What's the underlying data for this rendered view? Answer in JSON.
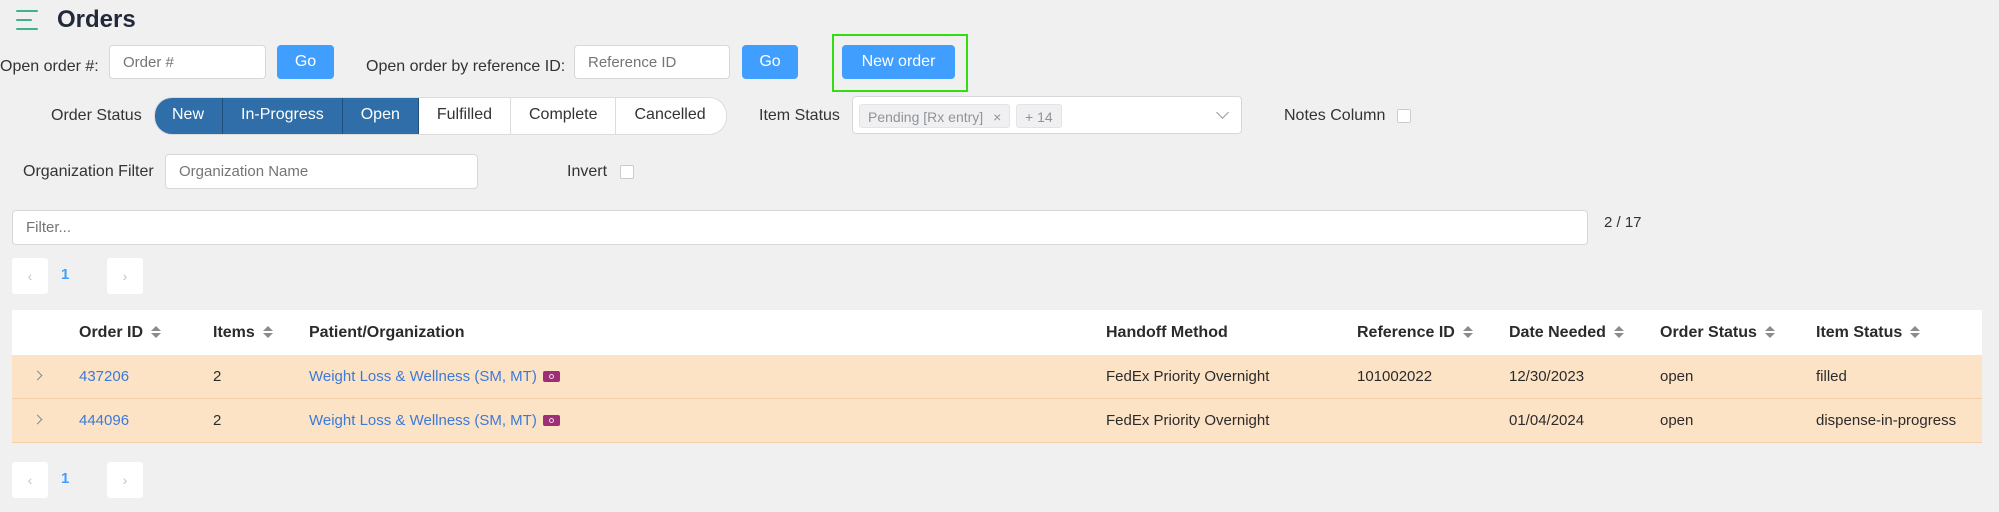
{
  "header": {
    "title": "Orders"
  },
  "open_order": {
    "label": "Open order #:",
    "placeholder": "Order #",
    "go_label": "Go"
  },
  "open_by_ref": {
    "label": "Open order by reference ID:",
    "placeholder": "Reference ID",
    "go_label": "Go"
  },
  "new_order_label": "New order",
  "order_status": {
    "label": "Order Status",
    "options": [
      {
        "label": "New",
        "selected": true
      },
      {
        "label": "In-Progress",
        "selected": true
      },
      {
        "label": "Open",
        "selected": true
      },
      {
        "label": "Fulfilled",
        "selected": false
      },
      {
        "label": "Complete",
        "selected": false
      },
      {
        "label": "Cancelled",
        "selected": false
      }
    ]
  },
  "item_status": {
    "label": "Item Status",
    "tag": "Pending [Rx entry]",
    "more_tag": "+ 14",
    "remove_icon": "×"
  },
  "notes_column": {
    "label": "Notes Column"
  },
  "org_filter": {
    "label": "Organization Filter",
    "placeholder": "Organization Name"
  },
  "invert": {
    "label": "Invert"
  },
  "filter": {
    "placeholder": "Filter...",
    "count": "2 / 17"
  },
  "pagination": {
    "prev_icon": "‹",
    "next_icon": "›",
    "current_page": "1"
  },
  "table": {
    "columns": [
      "Order ID",
      "Items",
      "Patient/Organization",
      "Handoff Method",
      "Reference ID",
      "Date Needed",
      "Order Status",
      "Item Status"
    ],
    "rows": [
      {
        "order_id": "437206",
        "items": "2",
        "patient": "Weight Loss & Wellness (SM, MT)",
        "handoff": "FedEx Priority Overnight",
        "reference_id": "101002022",
        "date_needed": "12/30/2023",
        "order_status": "open",
        "item_status": "filled"
      },
      {
        "order_id": "444096",
        "items": "2",
        "patient": "Weight Loss & Wellness (SM, MT)",
        "handoff": "FedEx Priority Overnight",
        "reference_id": "",
        "date_needed": "01/04/2024",
        "order_status": "open",
        "item_status": "dispense-in-progress"
      }
    ],
    "row_color": "#fde3c6"
  },
  "colors": {
    "accent": "#409eff",
    "selected_segment": "#2f6ea8",
    "highlight": "#33dd11",
    "menu_icon": "#3fb28a"
  }
}
